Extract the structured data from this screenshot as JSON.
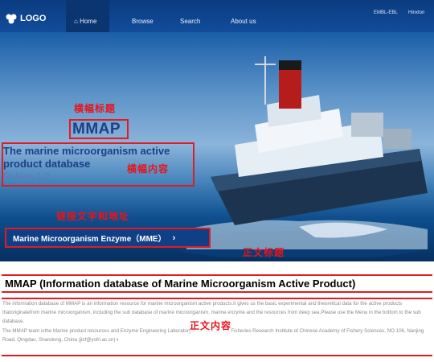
{
  "brand": {
    "logo_text": "LOGO"
  },
  "nav": {
    "items": [
      "Home",
      "Browse",
      "Search",
      "About us"
    ],
    "top_links": [
      "EMBL-EBL",
      "Hinxton"
    ]
  },
  "hero": {
    "annot_title_cn": "横幅标题",
    "title": "MMAP",
    "subtitle": "The marine microorganism active product database",
    "version": "Releas 1.0",
    "annot_content_cn": "横幅内容",
    "annot_link_cn": "链接文字和地址",
    "link_label": "Marine Microorganism Enzyme（MME）",
    "annot_section_title_cn": "正文标题"
  },
  "section": {
    "title": "MMAP (Information database of Marine Microorganism Active Product)",
    "paragraph1": "The information database of MMAP is an information resource for marine microorganism active products.It gives us the basic experimental and theoretical data for the active products thatoriginatefrom marine microorganism, including the sub database of marine microorganism, marine enzyme and the resources from deep sea.Please use the Menu in the bottom to the sub database.",
    "annot_body_cn": "正文内容",
    "paragraph2": "The MMAP team isthe Marine product resources and Enzyme Engineering Laboratoryat the Yellow Sea Fisheries Research Institute of Chinese Academy of Fishery Sciences, NO.106, Nanjing Road, Qingdao, Shandong, China (jixf@ysfri.ac.cn)",
    "more_arrow": "›"
  },
  "colors": {
    "annotation_red": "#e21b22",
    "nav_blue": "#0b3b80",
    "title_blue": "#1d3f86"
  }
}
